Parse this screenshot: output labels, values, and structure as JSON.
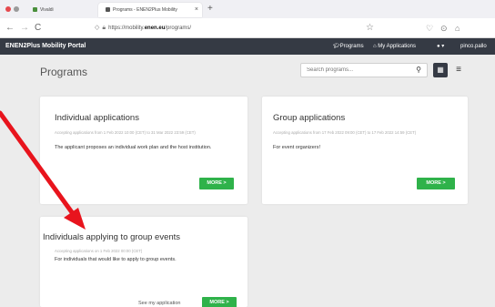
{
  "browser": {
    "tabs": [
      {
        "label": "Vivaldi"
      },
      {
        "label": "Programs - ENEN2Plus Mobility",
        "close": "×"
      }
    ],
    "new_tab": "+",
    "url_prefix": "https://mobility.",
    "url_bold": "enen.eu",
    "url_suffix": "/programs/",
    "nav": {
      "back": "←",
      "forward": "→",
      "reload": "C"
    },
    "star": "☆",
    "right_icons": [
      "♡",
      "⊙",
      "⌂"
    ]
  },
  "portal": {
    "title": "ENEN2Plus Mobility Portal",
    "nav": {
      "programs": "Programs",
      "my_applications": "My Applications",
      "user": "pinco.pallo",
      "dropdown": "▾"
    }
  },
  "page": {
    "title": "Programs",
    "search": {
      "placeholder": "Search programs..."
    }
  },
  "cards": [
    {
      "title": "Individual applications",
      "dates": "Accepting applications from 1 Feb 2022 10:00 (CET) to 31 Mar 2022 23:59 (CET)",
      "description": "The applicant proposes an individual work plan and the host institution.",
      "button": "MORE >"
    },
    {
      "title": "Group applications",
      "dates": "Accepting applications from 17 Feb 2022 09:00 (CET) to 17 Feb 2022 14:59 (CET)",
      "description": "For event organizers!",
      "button": "MORE >"
    },
    {
      "title": "Individuals applying to group events",
      "dates": "Accepting applications on 1 Feb 2022 00:00 (CET)",
      "description": "For individuals that would like to apply to group events.",
      "link": "See my application",
      "button": "MORE >"
    }
  ],
  "colors": {
    "nav_bg": "#353a44",
    "button_green": "#2fb24a",
    "arrow_red": "#e8141d"
  }
}
